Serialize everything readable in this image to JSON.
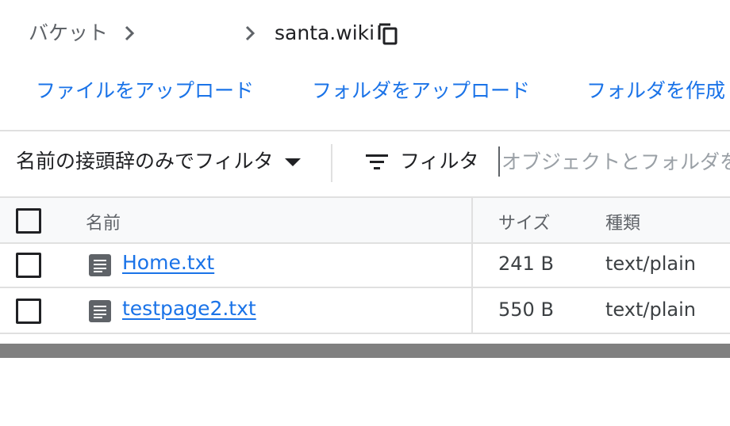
{
  "breadcrumb": {
    "bucket_label": "バケット",
    "current": "santa.wiki"
  },
  "actions": {
    "upload_files": "ファイルをアップロード",
    "upload_folder": "フォルダをアップロード",
    "create_folder": "フォルダを作成"
  },
  "filter": {
    "prefix_select": "名前の接頭辞のみでフィルタ",
    "label": "フィルタ",
    "placeholder": "オブジェクトとフォルダをフィルタ"
  },
  "table": {
    "columns": {
      "name": "名前",
      "size": "サイズ",
      "type": "種類"
    },
    "rows": [
      {
        "name": "Home.txt",
        "size": "241 B",
        "type": "text/plain"
      },
      {
        "name": "testpage2.txt",
        "size": "550 B",
        "type": "text/plain"
      }
    ]
  }
}
